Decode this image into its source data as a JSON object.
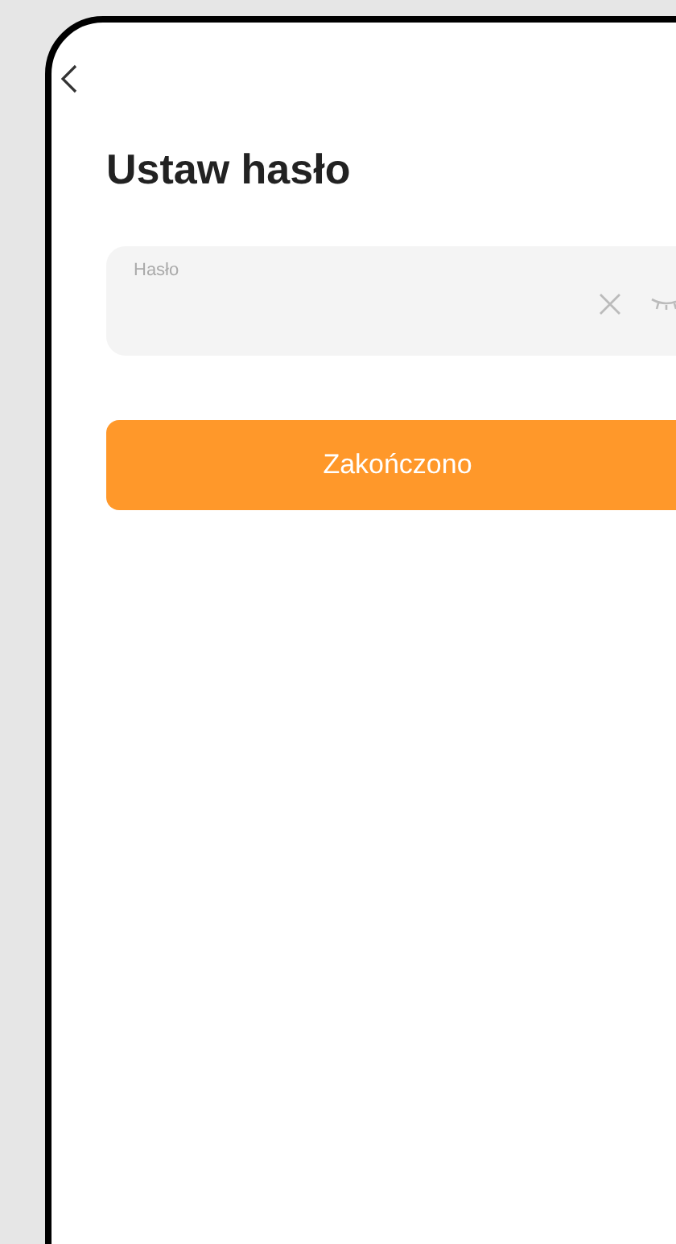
{
  "title": "Ustaw hasło",
  "password_field": {
    "label": "Hasło"
  },
  "buttons": [
    "Zakończono"
  ]
}
